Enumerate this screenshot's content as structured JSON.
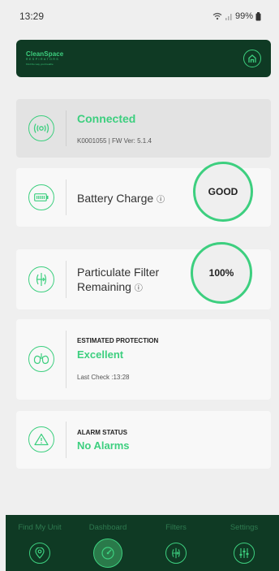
{
  "status_bar": {
    "time": "13:29",
    "battery": "99%"
  },
  "header": {
    "logo_main": "CleanSpace",
    "logo_sub": "RESPIRATORS",
    "logo_tag": "Find the way you breathe"
  },
  "connected": {
    "title": "Connected",
    "subtitle": "K0001055 | FW Ver: 5.1.4"
  },
  "battery": {
    "label": "Battery Charge",
    "info": "ⓘ",
    "value": "GOOD"
  },
  "filter": {
    "label_line1": "Particulate Filter",
    "label_line2": "Remaining",
    "info": "ⓘ",
    "value": "100%"
  },
  "protection": {
    "heading": "ESTIMATED PROTECTION",
    "value": "Excellent",
    "last_check": "Last Check :13:28"
  },
  "alarm": {
    "heading": "ALARM STATUS",
    "value": "No Alarms"
  },
  "nav": {
    "items": [
      {
        "label": "Find My Unit"
      },
      {
        "label": "Dashboard"
      },
      {
        "label": "Filters"
      },
      {
        "label": "Settings"
      }
    ]
  },
  "colors": {
    "accent": "#3dcf7f",
    "header_bg": "#0f3a24",
    "card_bg": "#f8f8f8",
    "page_bg": "#efefef"
  }
}
